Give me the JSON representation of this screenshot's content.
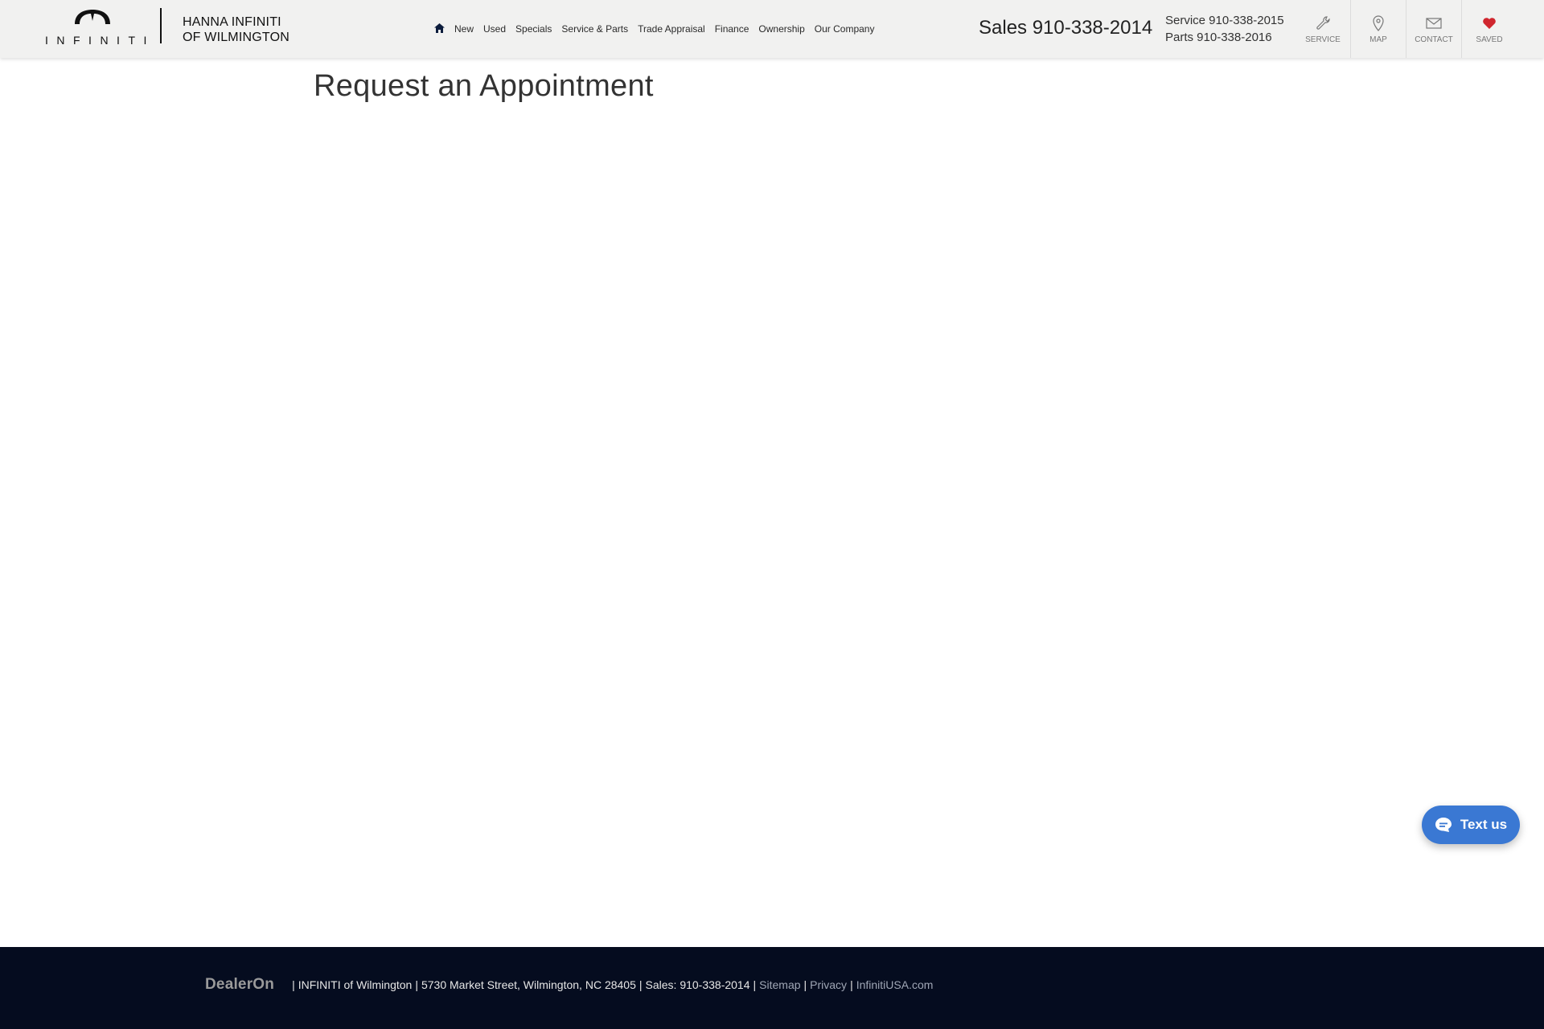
{
  "header": {
    "brand_wordmark": "INFINITI",
    "dealer_name_line1": "HANNA INFINITI",
    "dealer_name_line2": "OF WILMINGTON",
    "nav": [
      {
        "label": "New"
      },
      {
        "label": "Used"
      },
      {
        "label": "Specials"
      },
      {
        "label": "Service & Parts"
      },
      {
        "label": "Trade Appraisal"
      },
      {
        "label": "Finance"
      },
      {
        "label": "Ownership"
      },
      {
        "label": "Our Company"
      }
    ],
    "home_icon": "home-icon",
    "sales_phone": "Sales 910-338-2014",
    "service_phone": "Service 910-338-2015",
    "parts_phone": "Parts 910-338-2016",
    "quick_links": [
      {
        "label": "SERVICE",
        "icon": "wrench-icon"
      },
      {
        "label": "MAP",
        "icon": "map-pin-icon"
      },
      {
        "label": "CONTACT",
        "icon": "envelope-icon"
      },
      {
        "label": "SAVED",
        "icon": "heart-icon"
      }
    ]
  },
  "main": {
    "title": "Request an Appointment"
  },
  "chat_widget": {
    "label": "Text us",
    "icon": "chat-bubble-icon"
  },
  "footer": {
    "provider_logo": "DealerOn",
    "dealer": "INFINITI of Wilmington",
    "address": "5730 Market Street, Wilmington, NC 28405",
    "sales": "Sales: 910-338-2014",
    "links": [
      {
        "label": "Sitemap"
      },
      {
        "label": "Privacy"
      },
      {
        "label": "InfinitiUSA.com"
      }
    ]
  },
  "colors": {
    "header_bg": "#f1f1f0",
    "footer_bg": "#050c1f",
    "text_us_bg": "#3a78d3",
    "saved_heart": "#d0262e"
  }
}
